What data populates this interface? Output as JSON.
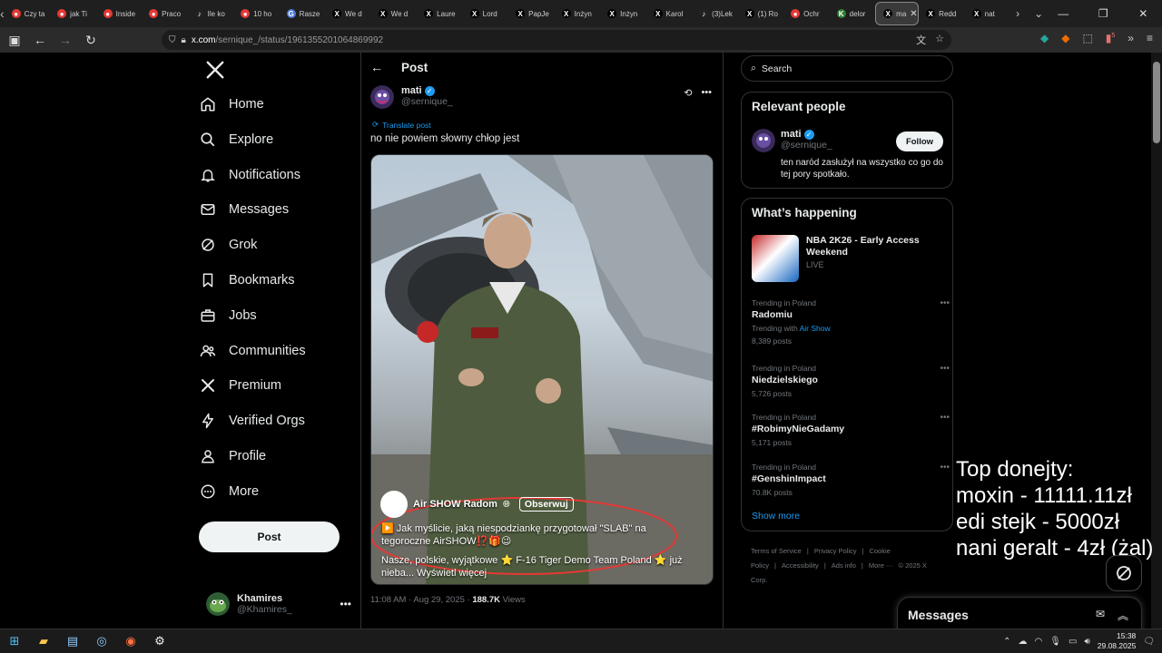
{
  "browser": {
    "tabs": [
      {
        "title": "Czy ta",
        "fav_color": "#e53935",
        "fav": "●"
      },
      {
        "title": "jak Ti",
        "fav_color": "#e53935",
        "fav": "●"
      },
      {
        "title": "Inside",
        "fav_color": "#e53935",
        "fav": "●"
      },
      {
        "title": "Praco",
        "fav_color": "#e53935",
        "fav": "●"
      },
      {
        "title": "Ile ko",
        "fav_color": "#222",
        "fav": "♪"
      },
      {
        "title": "10 ho",
        "fav_color": "#e53935",
        "fav": "●"
      },
      {
        "title": "Rasze",
        "fav_color": "#4a7bd6",
        "fav": "G"
      },
      {
        "title": "We d",
        "fav_color": "#000",
        "fav": "X"
      },
      {
        "title": "We d",
        "fav_color": "#000",
        "fav": "X"
      },
      {
        "title": "Laure",
        "fav_color": "#000",
        "fav": "X"
      },
      {
        "title": "Lord",
        "fav_color": "#000",
        "fav": "X"
      },
      {
        "title": "PapJe",
        "fav_color": "#000",
        "fav": "X"
      },
      {
        "title": "Inżyn",
        "fav_color": "#000",
        "fav": "X"
      },
      {
        "title": "Inżyn",
        "fav_color": "#000",
        "fav": "X"
      },
      {
        "title": "Karol",
        "fav_color": "#000",
        "fav": "X"
      },
      {
        "title": "(3)Lek",
        "fav_color": "#222",
        "fav": "♪"
      },
      {
        "title": "(1) Ro",
        "fav_color": "#000",
        "fav": "X"
      },
      {
        "title": "Ochr",
        "fav_color": "#e53935",
        "fav": "●"
      },
      {
        "title": "delor",
        "fav_color": "#2e7d32",
        "fav": "K"
      }
    ],
    "active_tab": {
      "title": "ma",
      "fav": "X"
    },
    "after_tabs": [
      {
        "title": "Redd",
        "fav": "X"
      },
      {
        "title": "nat",
        "fav": "X"
      }
    ],
    "url_host": "x.com",
    "url_path": "/sernique_/status/1961355201064869992",
    "ext_badge": "5"
  },
  "nav": {
    "items": [
      {
        "label": "Home",
        "icon": "home-icon"
      },
      {
        "label": "Explore",
        "icon": "search-icon"
      },
      {
        "label": "Notifications",
        "icon": "bell-icon"
      },
      {
        "label": "Messages",
        "icon": "envelope-icon"
      },
      {
        "label": "Grok",
        "icon": "grok-icon"
      },
      {
        "label": "Bookmarks",
        "icon": "bookmark-icon"
      },
      {
        "label": "Jobs",
        "icon": "briefcase-icon"
      },
      {
        "label": "Communities",
        "icon": "people-icon"
      },
      {
        "label": "Premium",
        "icon": "x-logo-icon"
      },
      {
        "label": "Verified Orgs",
        "icon": "lightning-icon"
      },
      {
        "label": "Profile",
        "icon": "person-icon"
      },
      {
        "label": "More",
        "icon": "more-circle-icon"
      }
    ],
    "post_label": "Post",
    "account": {
      "name": "Khamires",
      "handle": "@Khamires_"
    }
  },
  "post": {
    "header_title": "Post",
    "author_name": "mati",
    "author_handle": "@sernique_",
    "translate_label": "Translate post",
    "text": "no nie powiem słowny chłop jest",
    "overlay": {
      "page_name": "Air SHOW Radom",
      "follow_label": "Obserwuj",
      "line1": "▶️ Jak myślicie, jaką niespodziankę przygotował \"SLAB\" na tegoroczne AirSHOW⁉️🎁😉",
      "line2": "Nasze, polskie, wyjątkowe ⭐ F-16 Tiger Demo Team Poland ⭐ już nieba... Wyświetl więcej"
    },
    "timestamp": "11:08 AM · Aug 29, 2025 · ",
    "views": "188.7K",
    "views_label": " Views"
  },
  "right": {
    "search_placeholder": "Search",
    "relevant_title": "Relevant people",
    "relevant": {
      "name": "mati",
      "handle": "@sernique_",
      "follow_label": "Follow",
      "bio": "ten naród zasłużył na wszystko co go do tej pory spotkało."
    },
    "happening_title": "What’s happening",
    "feature": {
      "title": "NBA 2K26 - Early Access Weekend",
      "status": "LIVE"
    },
    "trends": [
      {
        "context": "Trending in Poland",
        "name": "Radomiu",
        "with_label": "Trending with ",
        "with": "Air Show",
        "count": "8,389 posts"
      },
      {
        "context": "Trending in Poland",
        "name": "Niedzielskiego",
        "count": "5,726 posts"
      },
      {
        "context": "Trending in Poland",
        "name": "#RobimyNieGadamy",
        "count": "5,171 posts"
      },
      {
        "context": "Trending in Poland",
        "name": "#GenshinImpact",
        "count": "70.8K posts"
      }
    ],
    "show_more": "Show more",
    "footer": [
      "Terms of Service",
      "|",
      "Privacy Policy",
      "|",
      "Cookie Policy",
      "|",
      "Accessibility",
      "|",
      "Ads info",
      "|",
      "More ···",
      "© 2025 X Corp."
    ]
  },
  "donations": {
    "title": "Top donejty:",
    "lines": [
      "moxin - 11111.11zł",
      "edi stejk - 5000zł",
      "nani geralt - 4zł (żal)"
    ]
  },
  "messages_drawer": {
    "title": "Messages"
  },
  "taskbar": {
    "time": "15:38",
    "date": "29.08.2025"
  }
}
